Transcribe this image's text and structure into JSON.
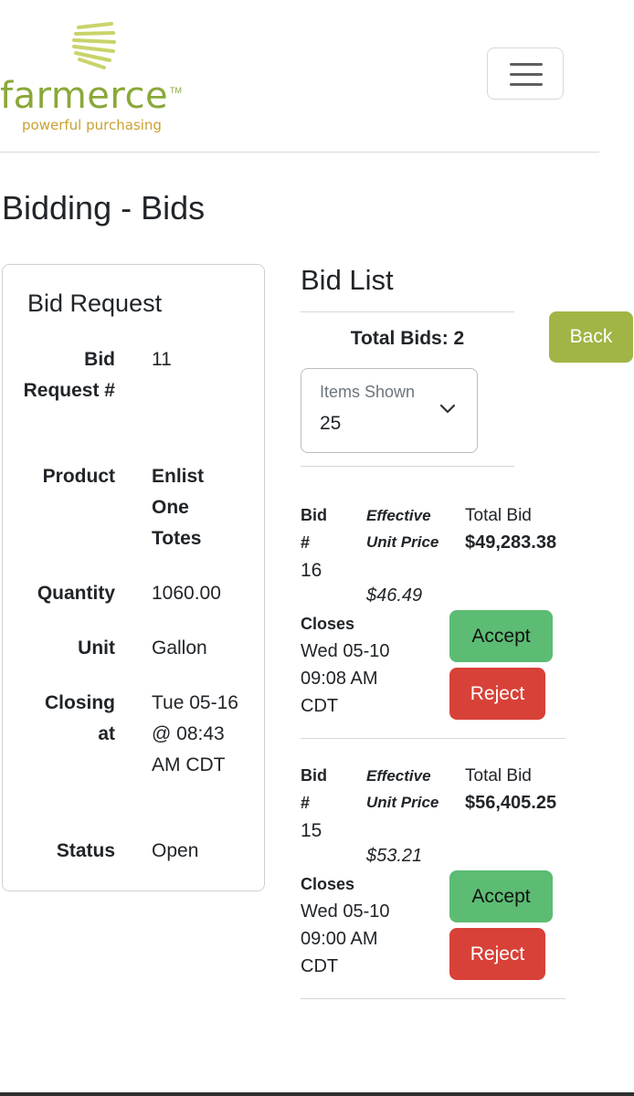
{
  "brand": {
    "name": "farmerce",
    "trademark": "TM",
    "tagline": "powerful purchasing",
    "colors": {
      "green": "#8aa838",
      "gold": "#c9a132",
      "navy": "#1f3b7a"
    }
  },
  "header": {
    "menu_icon": "hamburger-menu-icon"
  },
  "page": {
    "title": "Bidding - Bids"
  },
  "bid_request": {
    "heading": "Bid Request",
    "fields": [
      {
        "label": "Bid Request #",
        "value": "11"
      },
      {
        "label": "Product",
        "value": "Enlist One Totes"
      },
      {
        "label": "Quantity",
        "value": "1060.00"
      },
      {
        "label": "Unit",
        "value": "Gallon"
      },
      {
        "label": "Closing at",
        "value": "Tue 05-16 @ 08:43 AM CDT"
      },
      {
        "label": "Status",
        "value": "Open"
      }
    ]
  },
  "bid_list": {
    "heading": "Bid List",
    "total_bids": "Total Bids: 2",
    "back_label": "Back",
    "items_shown": {
      "label": "Items Shown",
      "value": "25"
    },
    "bids": [
      {
        "bid_label": "Bid #",
        "bid_number": "16",
        "unit_price_label": "Effective Unit Price",
        "unit_price": "$46.49",
        "total_label": "Total Bid",
        "total": "$49,283.38",
        "closes_label": "Closes",
        "closes": "Wed 05-10 09:08 AM CDT",
        "accept_label": "Accept",
        "reject_label": "Reject"
      },
      {
        "bid_label": "Bid #",
        "bid_number": "15",
        "unit_price_label": "Effective Unit Price",
        "unit_price": "$53.21",
        "total_label": "Total Bid",
        "total": "$56,405.25",
        "closes_label": "Closes",
        "closes": "Wed 05-10 09:00 AM CDT",
        "accept_label": "Accept",
        "reject_label": "Reject"
      }
    ]
  },
  "colors": {
    "back_button": "#a0b545",
    "accept_button": "#5cbc73",
    "reject_button": "#d84138"
  }
}
